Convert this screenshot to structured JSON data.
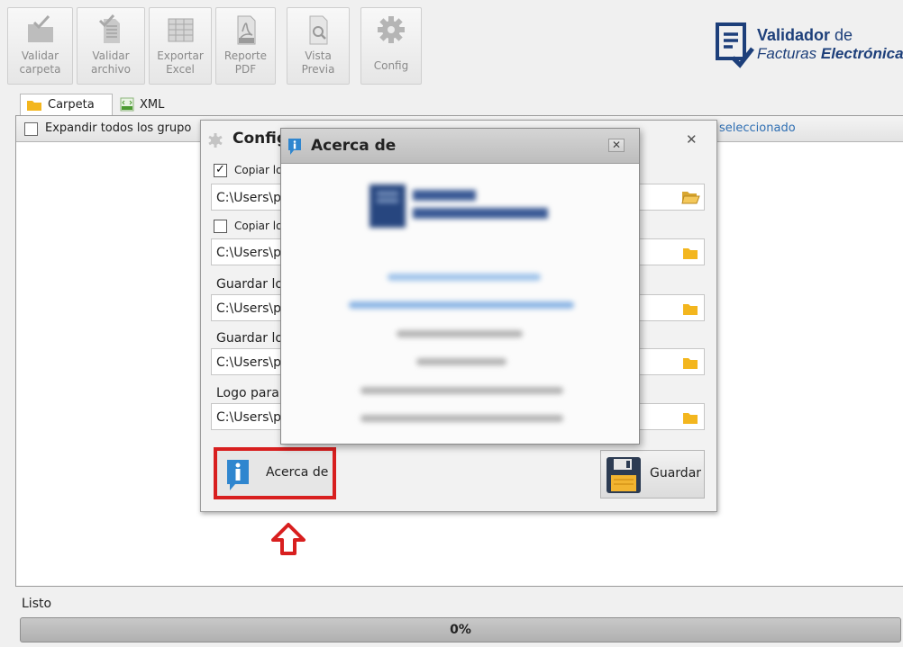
{
  "toolbar": {
    "buttons": [
      {
        "label": "Validar\ncarpeta",
        "icon": "folder-check-icon"
      },
      {
        "label": "Validar\narchivo",
        "icon": "file-check-icon"
      },
      {
        "label": "Exportar\nExcel",
        "icon": "spreadsheet-icon"
      },
      {
        "label": "Reporte\nPDF",
        "icon": "pdf-icon"
      },
      {
        "label": "Vista\nPrevia",
        "icon": "preview-icon"
      },
      {
        "label": "Config",
        "icon": "gear-icon"
      }
    ]
  },
  "logo": {
    "brand": "Validador",
    "de": "de",
    "line2a": "Facturas",
    "line2b": "Electrónicas"
  },
  "tabs": [
    {
      "label": "Carpeta",
      "icon": "folder-icon",
      "active": true
    },
    {
      "label": "XML",
      "icon": "xml-icon",
      "active": false
    }
  ],
  "panel": {
    "expand_label": "Expandir todos los grupo",
    "selected_label": "seleccionado"
  },
  "config": {
    "title": "Config",
    "rows": [
      {
        "type": "check",
        "checked": true,
        "label": "Copiar lo",
        "path": "C:\\Users\\p"
      },
      {
        "type": "check",
        "checked": false,
        "label": "Copiar lo",
        "path": "C:\\Users\\p"
      },
      {
        "type": "label",
        "label": "Guardar lo",
        "path": "C:\\Users\\p"
      },
      {
        "type": "label",
        "label": "Guardar lo",
        "path": "C:\\Users\\p"
      },
      {
        "type": "label",
        "label": "Logo para",
        "path": "C:\\Users\\p"
      }
    ],
    "about_button": "Acerca de",
    "save_button": "Guardar",
    "close": "✕"
  },
  "about": {
    "title": "Acerca de",
    "close": "✕"
  },
  "status": {
    "label": "Listo",
    "progress_text": "0%",
    "progress": 0
  },
  "colors": {
    "highlight": "#d81f1f",
    "brand": "#1d3f7a",
    "link": "#2f6fb3"
  }
}
